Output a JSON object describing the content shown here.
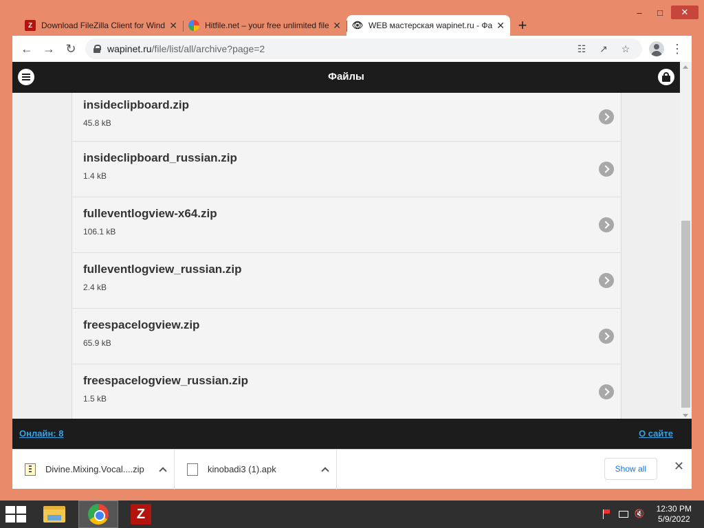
{
  "browser": {
    "tabs": [
      {
        "title": "Download FileZilla Client for Windows",
        "favicon": "filezilla-icon",
        "active": false
      },
      {
        "title": "Hitfile.net – your free unlimited file",
        "favicon": "hitfile-icon",
        "active": false
      },
      {
        "title": "WEB мастерская wapinet.ru - Файлы",
        "favicon": "eye-icon",
        "active": true
      }
    ],
    "url_host": "wapinet.ru",
    "url_path": "/file/list/all/archive?page=2"
  },
  "site": {
    "title": "Файлы",
    "files": [
      {
        "name": "insideclipboard.zip",
        "size": "45.8 kB"
      },
      {
        "name": "insideclipboard_russian.zip",
        "size": "1.4 kB"
      },
      {
        "name": "fulleventlogview-x64.zip",
        "size": "106.1 kB"
      },
      {
        "name": "fulleventlogview_russian.zip",
        "size": "2.4 kB"
      },
      {
        "name": "freespacelogview.zip",
        "size": "65.9 kB"
      },
      {
        "name": "freespacelogview_russian.zip",
        "size": "1.5 kB"
      }
    ],
    "footer": {
      "online": "Онлайн: 8",
      "about": "О сайте"
    }
  },
  "downloads": {
    "items": [
      {
        "name": "Divine.Mixing.Vocal....zip"
      },
      {
        "name": "kinobadi3 (1).apk"
      }
    ],
    "show_all": "Show all"
  },
  "taskbar": {
    "time": "12:30 PM",
    "date": "5/9/2022"
  }
}
